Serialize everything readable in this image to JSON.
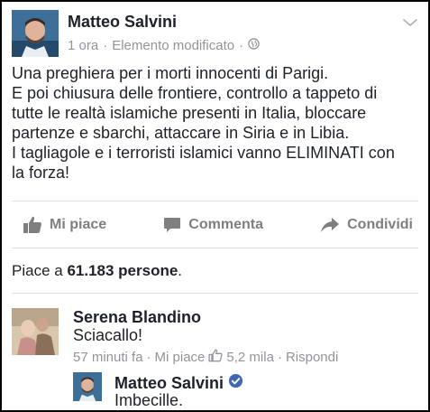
{
  "post": {
    "author": "Matteo Salvini",
    "time": "1 ora",
    "edited": "Elemento modificato",
    "sep1": "·",
    "sep2": "·",
    "lines": [
      "Una preghiera per i morti innocenti di Parigi.",
      "E poi chiusura delle frontiere, controllo a tappeto di",
      "tutte le realtà islamiche presenti in Italia, bloccare",
      "partenze e sbarchi, attaccare in Siria e in Libia.",
      "I tagliagole e i terroristi islamici vanno ELIMINATI con",
      "la forza!"
    ],
    "privacy_icon": "globe-icon",
    "menu_icon": "chevron-down-icon"
  },
  "actions": {
    "like": "Mi piace",
    "comment": "Commenta",
    "share": "Condividi"
  },
  "likes": {
    "prefix": "Piace a",
    "count": "61.183 persone",
    "suffix": "."
  },
  "comment": {
    "author": "Serena Blandino",
    "text": "Sciacallo!",
    "time": "57 minuti fa",
    "like": "Mi piace",
    "likes_count": "5,2 mila",
    "reply": "Rispondi",
    "sep": "·"
  },
  "reply": {
    "author": "Matteo Salvini",
    "text": "Imbecille.",
    "verified_icon": "verified-badge-icon"
  },
  "colors": {
    "text": "#1d2129",
    "muted": "#90949c",
    "action": "#7f7f7f",
    "verified": "#4267b2",
    "divider": "#dddfe2"
  }
}
